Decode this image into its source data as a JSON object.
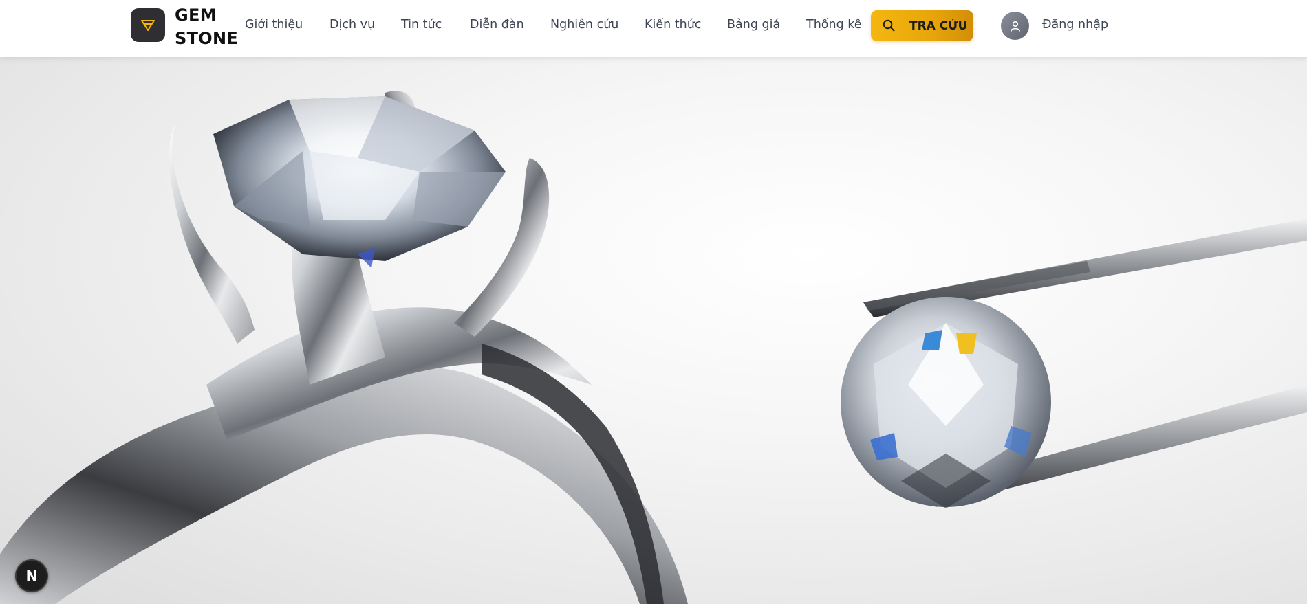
{
  "brand": {
    "line1": "GEM",
    "line2": "STONE",
    "logo_icon": "diamond-outline-icon",
    "accent": "#f4b710"
  },
  "nav": {
    "items": [
      {
        "label": "Giới thiệu"
      },
      {
        "label": "Dịch vụ"
      },
      {
        "label": "Tin tức"
      },
      {
        "label": "Diễn đàn"
      },
      {
        "label": "Nghiên cứu"
      },
      {
        "label": "Kiến thức"
      },
      {
        "label": "Bảng giá"
      },
      {
        "label": "Thống kê"
      }
    ],
    "lookup_button": {
      "label": "TRA CỨU",
      "icon": "search-icon",
      "color": "#f4b710"
    },
    "login": {
      "label": "Đăng nhập",
      "icon": "user-icon"
    }
  },
  "hero": {
    "subject": "hero-image-diamond-ring-and-tweezers"
  },
  "dev_badge": {
    "label": "N"
  }
}
